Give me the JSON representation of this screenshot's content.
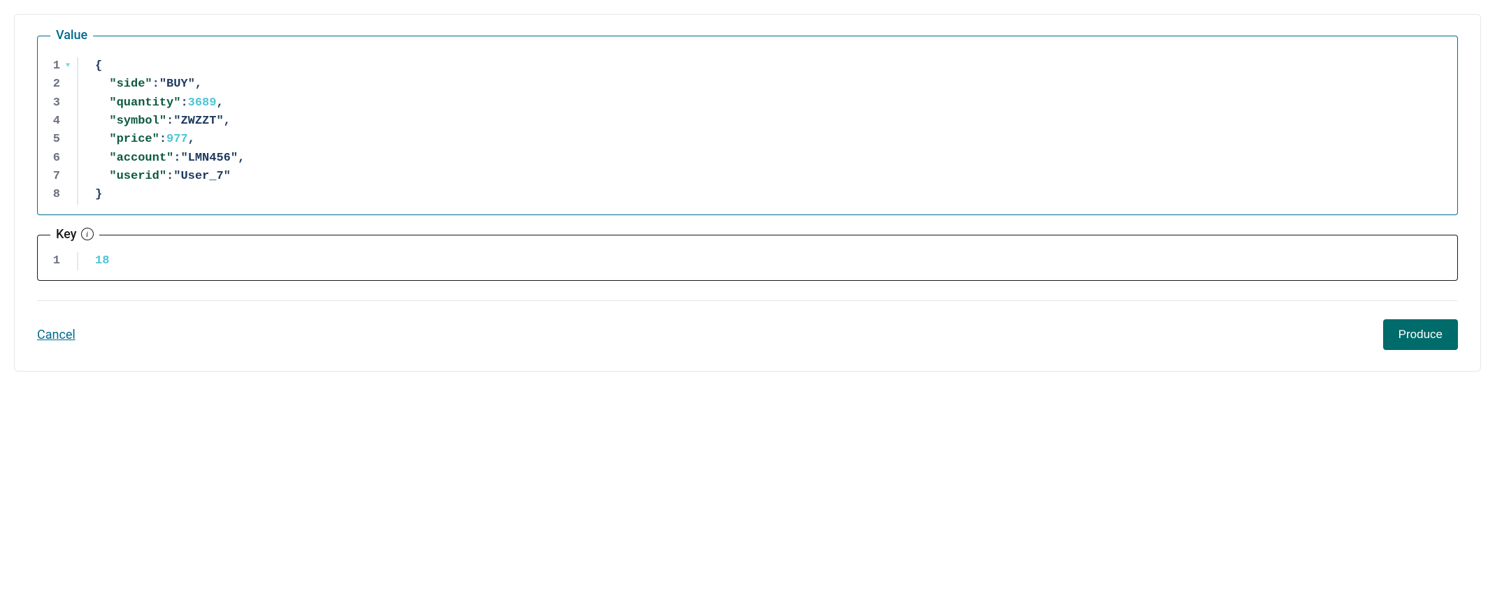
{
  "valueField": {
    "label": "Value",
    "lineNumbers": [
      "1",
      "2",
      "3",
      "4",
      "5",
      "6",
      "7",
      "8"
    ],
    "json": {
      "side": "BUY",
      "quantity": 3689,
      "symbol": "ZWZZT",
      "price": 977,
      "account": "LMN456",
      "userid": "User_7"
    },
    "tokens": {
      "openBrace": "{",
      "closeBrace": "}",
      "colon": ":",
      "comma": ",",
      "quote": "\"",
      "keys": {
        "side": "side",
        "quantity": "quantity",
        "symbol": "symbol",
        "price": "price",
        "account": "account",
        "userid": "userid"
      },
      "values": {
        "side": "BUY",
        "quantity": "3689",
        "symbol": "ZWZZT",
        "price": "977",
        "account": "LMN456",
        "userid": "User_7"
      }
    }
  },
  "keyField": {
    "label": "Key",
    "lineNumbers": [
      "1"
    ],
    "value": "18"
  },
  "actions": {
    "cancel": "Cancel",
    "produce": "Produce"
  }
}
